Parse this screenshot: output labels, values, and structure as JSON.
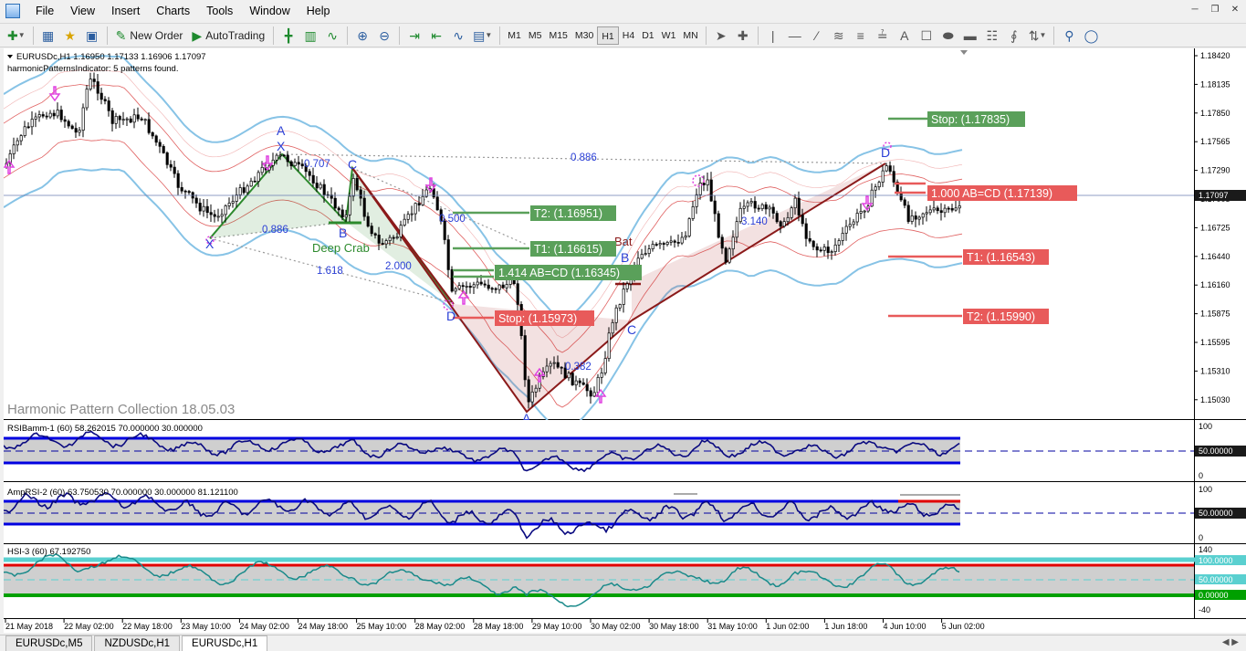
{
  "menu": {
    "items": [
      "File",
      "View",
      "Insert",
      "Charts",
      "Tools",
      "Window",
      "Help"
    ]
  },
  "toolbar": {
    "new_order": "New Order",
    "autotrading": "AutoTrading",
    "timeframes": [
      "M1",
      "M5",
      "M15",
      "M30",
      "H1",
      "H4",
      "D1",
      "W1",
      "MN"
    ],
    "active_timeframe": "H1",
    "text_tool": "A"
  },
  "chart": {
    "symbol_header": "EURUSDc,H1  1.16950 1.17133 1.16906 1.17097",
    "indicator_status": "harmonicPatternsIndicator: 5 patterns found.",
    "watermark": "Harmonic Pattern Collection 18.05.03",
    "current_price": "1.17097",
    "price_axis": [
      "1.18420",
      "1.18135",
      "1.17850",
      "1.17565",
      "1.17290",
      "1.17005",
      "1.16725",
      "1.16440",
      "1.16160",
      "1.15875",
      "1.15595",
      "1.15310",
      "1.15030"
    ],
    "pattern_letters": {
      "x1": "X",
      "a1": "A",
      "b1": "B",
      "c1": "C",
      "d1": "D",
      "a2": "A",
      "b2": "B",
      "c2": "C",
      "d2": "D",
      "x2": "X"
    },
    "pattern_names": {
      "deep_crab": "Deep Crab",
      "bat": "Bat"
    },
    "ratios": {
      "r0707": "0.707",
      "r0886a": "0.886",
      "r1618": "1.618",
      "r2000": "2.000",
      "r0500": "0.500",
      "r0886b": "0.886",
      "r0382": "0.382",
      "r3140": "3.140"
    },
    "labels": {
      "t2_left": "T2: (1.16951)",
      "t1_left": "T1: (1.16615)",
      "abcd_left": "1.414 AB=CD (1.16345)",
      "stop_left": "Stop: (1.15973)",
      "stop_right": "Stop: (1.17835)",
      "abcd_right": "1.000 AB=CD (1.17139)",
      "t1_right": "T1: (1.16543)",
      "t2_right": "T2: (1.15990)"
    }
  },
  "indicators": {
    "rsi": {
      "header": "RSIBamm-1 (60) 58.262015 70.000000 30.000000",
      "axis_top": "100",
      "axis_mid": "50.00000",
      "axis_bottom": "0"
    },
    "amprsi": {
      "header": "AmpRSI-2 (60) 63.750530 70.000000 30.000000 81.121100",
      "axis_top": "100",
      "axis_mid": "50.00000",
      "axis_bottom": "0"
    },
    "hsi": {
      "header": "HSI-3 (60) 67.192750",
      "axis_top": "140",
      "axis_100": "100.0000",
      "axis_mid": "50.00000",
      "axis_zero": "0.00000",
      "axis_bottom": "-40"
    }
  },
  "time_axis": [
    "21 May 2018",
    "22 May 02:00",
    "22 May 18:00",
    "23 May 10:00",
    "24 May 02:00",
    "24 May 18:00",
    "25 May 10:00",
    "28 May 02:00",
    "28 May 18:00",
    "29 May 10:00",
    "30 May 02:00",
    "30 May 18:00",
    "31 May 10:00",
    "1 Jun 02:00",
    "1 Jun 18:00",
    "4 Jun 10:00",
    "5 Jun 02:00"
  ],
  "tabs": [
    "EURUSDc,M5",
    "NZDUSDc,H1",
    "EURUSDc,H1"
  ],
  "active_tab": "EURUSDc,H1",
  "colors": {
    "bull_target": "#5aa05a",
    "bear_target": "#e85a5a",
    "bollinger": "#87c3e6",
    "envelope": "#e06060",
    "pattern_line": "#8b1a1a",
    "pattern_green": "#2d8a2d",
    "rsi_level": "#0000e0",
    "hsi_line": "#1a8a8a",
    "hsi_top": "#5ad0d0",
    "hsi_red": "#e00000",
    "hsi_green": "#00a000"
  }
}
